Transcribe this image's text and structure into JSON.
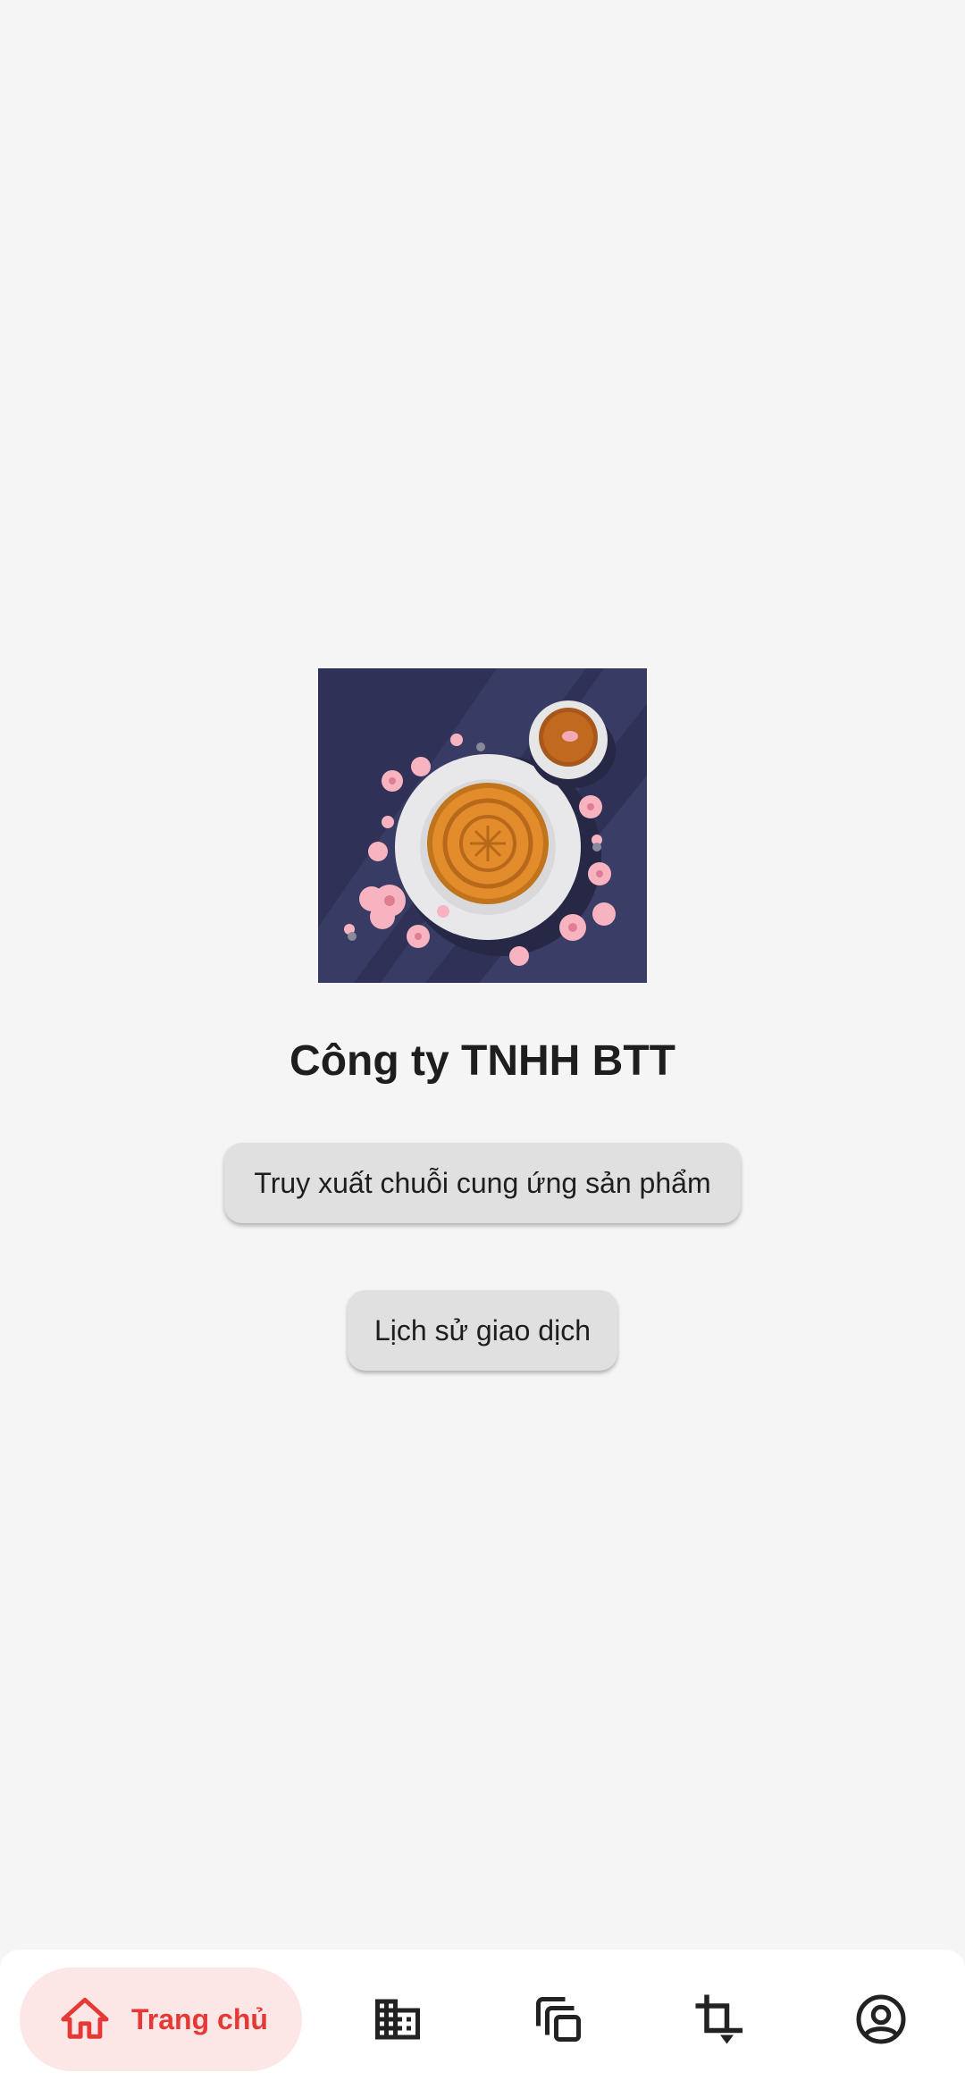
{
  "main": {
    "company_name": "Công ty TNHH BTT",
    "hero_image": "mooncake-tea-illustration",
    "buttons": {
      "trace": "Truy xuất chuỗi cung ứng sản phẩm",
      "history": "Lịch sử giao dịch"
    }
  },
  "bottom_nav": {
    "items": [
      {
        "label": "Trang chủ",
        "icon": "home-icon",
        "active": true
      },
      {
        "label": "",
        "icon": "building-icon",
        "active": false
      },
      {
        "label": "",
        "icon": "copy-icon",
        "active": false
      },
      {
        "label": "",
        "icon": "crop-icon",
        "active": false
      },
      {
        "label": "",
        "icon": "account-icon",
        "active": false
      }
    ]
  },
  "colors": {
    "accent": "#e53935",
    "active_pill": "#fde6e6",
    "background": "#f5f5f5",
    "button": "#e0e0e0",
    "hero_background": "#2f3157"
  }
}
